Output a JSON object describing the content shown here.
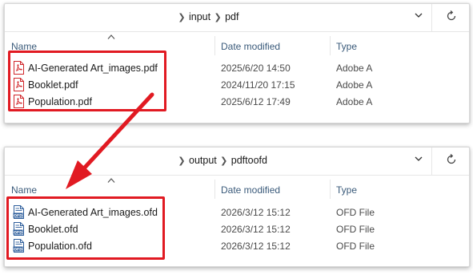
{
  "top_window": {
    "breadcrumb": [
      "input",
      "pdf"
    ],
    "columns": {
      "name": "Name",
      "date": "Date modified",
      "type": "Type"
    },
    "files": [
      {
        "name": "AI-Generated Art_images.pdf",
        "date": "2025/6/20 14:50",
        "type": "Adobe A",
        "icon": "pdf-file-icon"
      },
      {
        "name": "Booklet.pdf",
        "date": "2024/11/20 17:15",
        "type": "Adobe A",
        "icon": "pdf-file-icon"
      },
      {
        "name": "Population.pdf",
        "date": "2025/6/12 17:49",
        "type": "Adobe A",
        "icon": "pdf-file-icon"
      }
    ]
  },
  "bottom_window": {
    "breadcrumb": [
      "output",
      "pdftoofd"
    ],
    "columns": {
      "name": "Name",
      "date": "Date modified",
      "type": "Type"
    },
    "files": [
      {
        "name": "AI-Generated Art_images.ofd",
        "date": "2026/3/12 15:12",
        "type": "OFD File",
        "icon": "ofd-file-icon"
      },
      {
        "name": "Booklet.ofd",
        "date": "2026/3/12 15:12",
        "type": "OFD File",
        "icon": "ofd-file-icon"
      },
      {
        "name": "Population.ofd",
        "date": "2026/3/12 15:12",
        "type": "OFD File",
        "icon": "ofd-file-icon"
      }
    ]
  },
  "colors": {
    "highlight": "#e11a22",
    "pdf_icon": "#d0262a",
    "ofd_icon": "#2f5f9c",
    "header_text": "#3a5a7a"
  }
}
